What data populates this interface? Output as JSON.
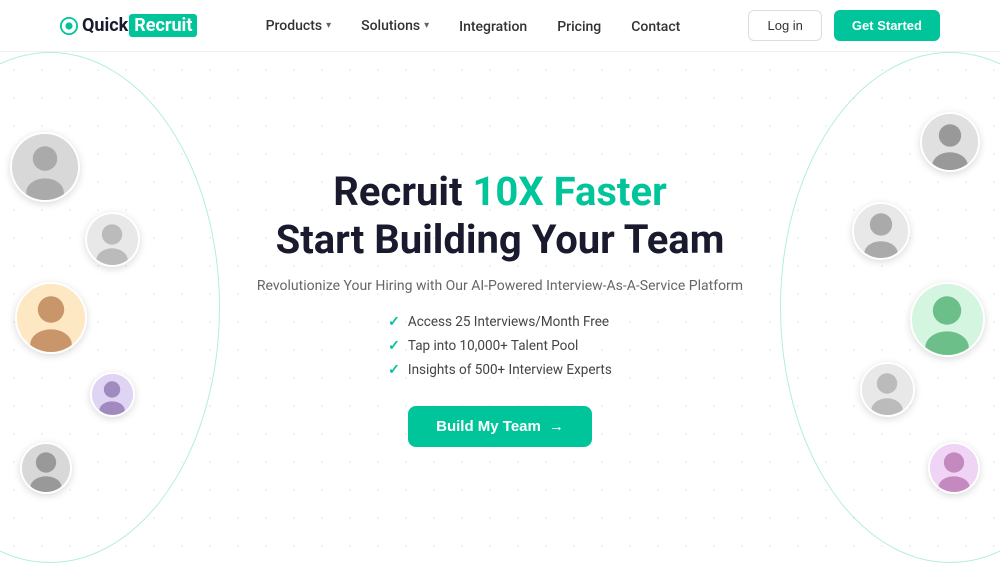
{
  "logo": {
    "quick": "Quick",
    "recruit": "Recruit"
  },
  "nav": {
    "links": [
      {
        "label": "Products",
        "hasDropdown": true
      },
      {
        "label": "Solutions",
        "hasDropdown": true
      },
      {
        "label": "Integration",
        "hasDropdown": false
      },
      {
        "label": "Pricing",
        "hasDropdown": false
      },
      {
        "label": "Contact",
        "hasDropdown": false
      }
    ],
    "login_label": "Log in",
    "get_started_label": "Get Started"
  },
  "hero": {
    "title_line1_plain": "Recruit ",
    "title_line1_highlight": "10X Faster",
    "title_line2": "Start Building Your Team",
    "subtitle": "Revolutionize Your Hiring with Our AI-Powered Interview-As-A-Service Platform",
    "features": [
      "Access 25 Interviews/Month Free",
      "Tap into 10,000+ Talent Pool",
      "Insights of 500+ Interview Experts"
    ],
    "cta_label": "Build My Team",
    "cta_arrow": "→"
  },
  "colors": {
    "brand_green": "#00c49a",
    "dark": "#1a1a2e",
    "text_gray": "#666666"
  },
  "avatars": {
    "left": [
      {
        "id": "l1",
        "bg": "#e0e0e0"
      },
      {
        "id": "l2",
        "bg": "#f0f0f0"
      },
      {
        "id": "l3",
        "bg": "#fde8c3"
      },
      {
        "id": "l4",
        "bg": "#e0d4f5"
      },
      {
        "id": "l5",
        "bg": "#e0e0e0"
      }
    ],
    "right": [
      {
        "id": "r1",
        "bg": "#e8e8e8"
      },
      {
        "id": "r2",
        "bg": "#e8e8e8"
      },
      {
        "id": "r3",
        "bg": "#d4f5e0"
      },
      {
        "id": "r4",
        "bg": "#e8e8e8"
      },
      {
        "id": "r5",
        "bg": "#f0d4f5"
      }
    ]
  }
}
